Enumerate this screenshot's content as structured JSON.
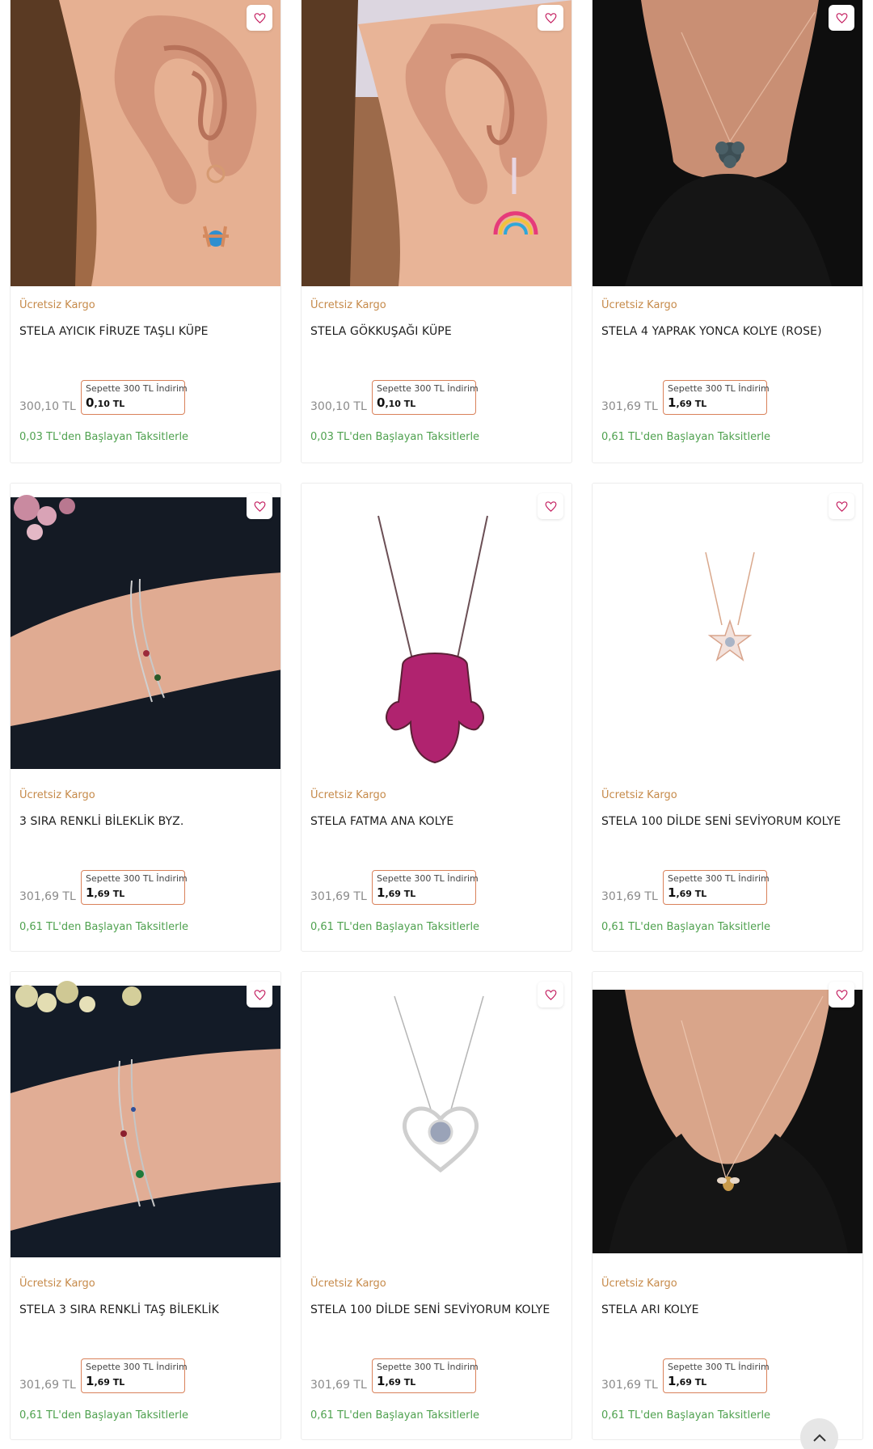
{
  "colors": {
    "shipping": "#c68a4a",
    "installment": "#4fa14f",
    "basket_border": "#d9825b",
    "heart": "#c2185b"
  },
  "products": [
    {
      "shipping": "Ücretsiz Kargo",
      "title": "STELA AYICIK FİRUZE TAŞLI KÜPE",
      "old_price": "300,10 TL",
      "basket_label": "Sepette 300 TL İndirim",
      "price_main": "0",
      "price_rest": ",10 TL",
      "installment": "0,03 TL'den Başlayan Taksitlerle",
      "image": "earring-turquoise-bear"
    },
    {
      "shipping": "Ücretsiz Kargo",
      "title": "STELA GÖKKUŞAĞI KÜPE",
      "old_price": "300,10 TL",
      "basket_label": "Sepette 300 TL İndirim",
      "price_main": "0",
      "price_rest": ",10 TL",
      "installment": "0,03 TL'den Başlayan Taksitlerle",
      "image": "earring-rainbow"
    },
    {
      "shipping": "Ücretsiz Kargo",
      "title": "STELA 4 YAPRAK YONCA KOLYE (ROSE)",
      "old_price": "301,69 TL",
      "basket_label": "Sepette 300 TL İndirim",
      "price_main": "1",
      "price_rest": ",69 TL",
      "installment": "0,61 TL'den Başlayan Taksitlerle",
      "image": "necklace-clover"
    },
    {
      "shipping": "Ücretsiz Kargo",
      "title": "3 SIRA RENKLİ BİLEKLİK BYZ.",
      "old_price": "301,69 TL",
      "basket_label": "Sepette 300 TL İndirim",
      "price_main": "1",
      "price_rest": ",69 TL",
      "installment": "0,61 TL'den Başlayan Taksitlerle",
      "image": "bracelet-3row"
    },
    {
      "shipping": "Ücretsiz Kargo",
      "title": "STELA FATMA ANA KOLYE",
      "old_price": "301,69 TL",
      "basket_label": "Sepette 300 TL İndirim",
      "price_main": "1",
      "price_rest": ",69 TL",
      "installment": "0,61 TL'den Başlayan Taksitlerle",
      "image": "necklace-hamsa"
    },
    {
      "shipping": "Ücretsiz Kargo",
      "title": "STELA 100 DİLDE SENİ SEVİYORUM KOLYE",
      "old_price": "301,69 TL",
      "basket_label": "Sepette 300 TL İndirim",
      "price_main": "1",
      "price_rest": ",69 TL",
      "installment": "0,61 TL'den Başlayan Taksitlerle",
      "image": "necklace-star"
    },
    {
      "shipping": "Ücretsiz Kargo",
      "title": "STELA 3 SIRA RENKLİ TAŞ BİLEKLİK",
      "old_price": "301,69 TL",
      "basket_label": "Sepette 300 TL İndirim",
      "price_main": "1",
      "price_rest": ",69 TL",
      "installment": "0,61 TL'den Başlayan Taksitlerle",
      "image": "bracelet-stones"
    },
    {
      "shipping": "Ücretsiz Kargo",
      "title": "STELA 100 DİLDE SENİ SEVİYORUM KOLYE",
      "old_price": "301,69 TL",
      "basket_label": "Sepette 300 TL İndirim",
      "price_main": "1",
      "price_rest": ",69 TL",
      "installment": "0,61 TL'den Başlayan Taksitlerle",
      "image": "necklace-heart"
    },
    {
      "shipping": "Ücretsiz Kargo",
      "title": "STELA ARI KOLYE",
      "old_price": "301,69 TL",
      "basket_label": "Sepette 300 TL İndirim",
      "price_main": "1",
      "price_rest": ",69 TL",
      "installment": "0,61 TL'den Başlayan Taksitlerle",
      "image": "necklace-bee"
    }
  ],
  "scroll_top_icon": "chevron-up-icon",
  "favorite_icon": "heart-outline-icon"
}
